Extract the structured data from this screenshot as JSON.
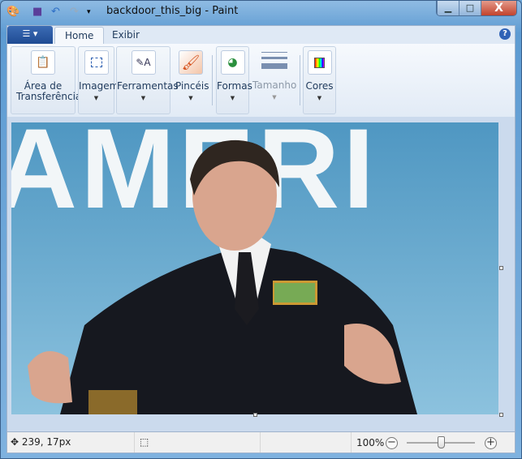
{
  "window": {
    "title": "backdoor_this_big - Paint",
    "minimize": "▁",
    "maximize": "□",
    "close": "X"
  },
  "quick_access": {
    "app_icon": "paint-palette-icon",
    "save_icon": "save-icon",
    "undo_icon": "undo-icon",
    "redo_icon": "redo-icon",
    "customize_icon": "dropdown-icon"
  },
  "ribbon": {
    "app_menu": "☰ ▾",
    "tabs": [
      {
        "label": "Home",
        "active": true
      },
      {
        "label": "Exibir",
        "active": false
      }
    ],
    "help": "?",
    "groups": [
      {
        "label": "Área de Transferência",
        "icon": "clipboard-icon"
      },
      {
        "label": "Imagem",
        "icon": "select-icon"
      },
      {
        "label": "Ferramentas",
        "icon": "tools-icon"
      },
      {
        "label": "Pincéis",
        "icon": "brush-icon"
      },
      {
        "label": "Formas",
        "icon": "shapes-icon"
      },
      {
        "label": "Tamanho",
        "icon": "size-icon",
        "disabled": true
      },
      {
        "label": "Cores",
        "icon": "colors-icon"
      }
    ]
  },
  "canvas": {
    "image_text": "AMERI"
  },
  "status": {
    "position": "239, 17px",
    "zoom_label": "100%",
    "zoom_percent": 100,
    "zoom_out": "−",
    "zoom_in": "+"
  }
}
